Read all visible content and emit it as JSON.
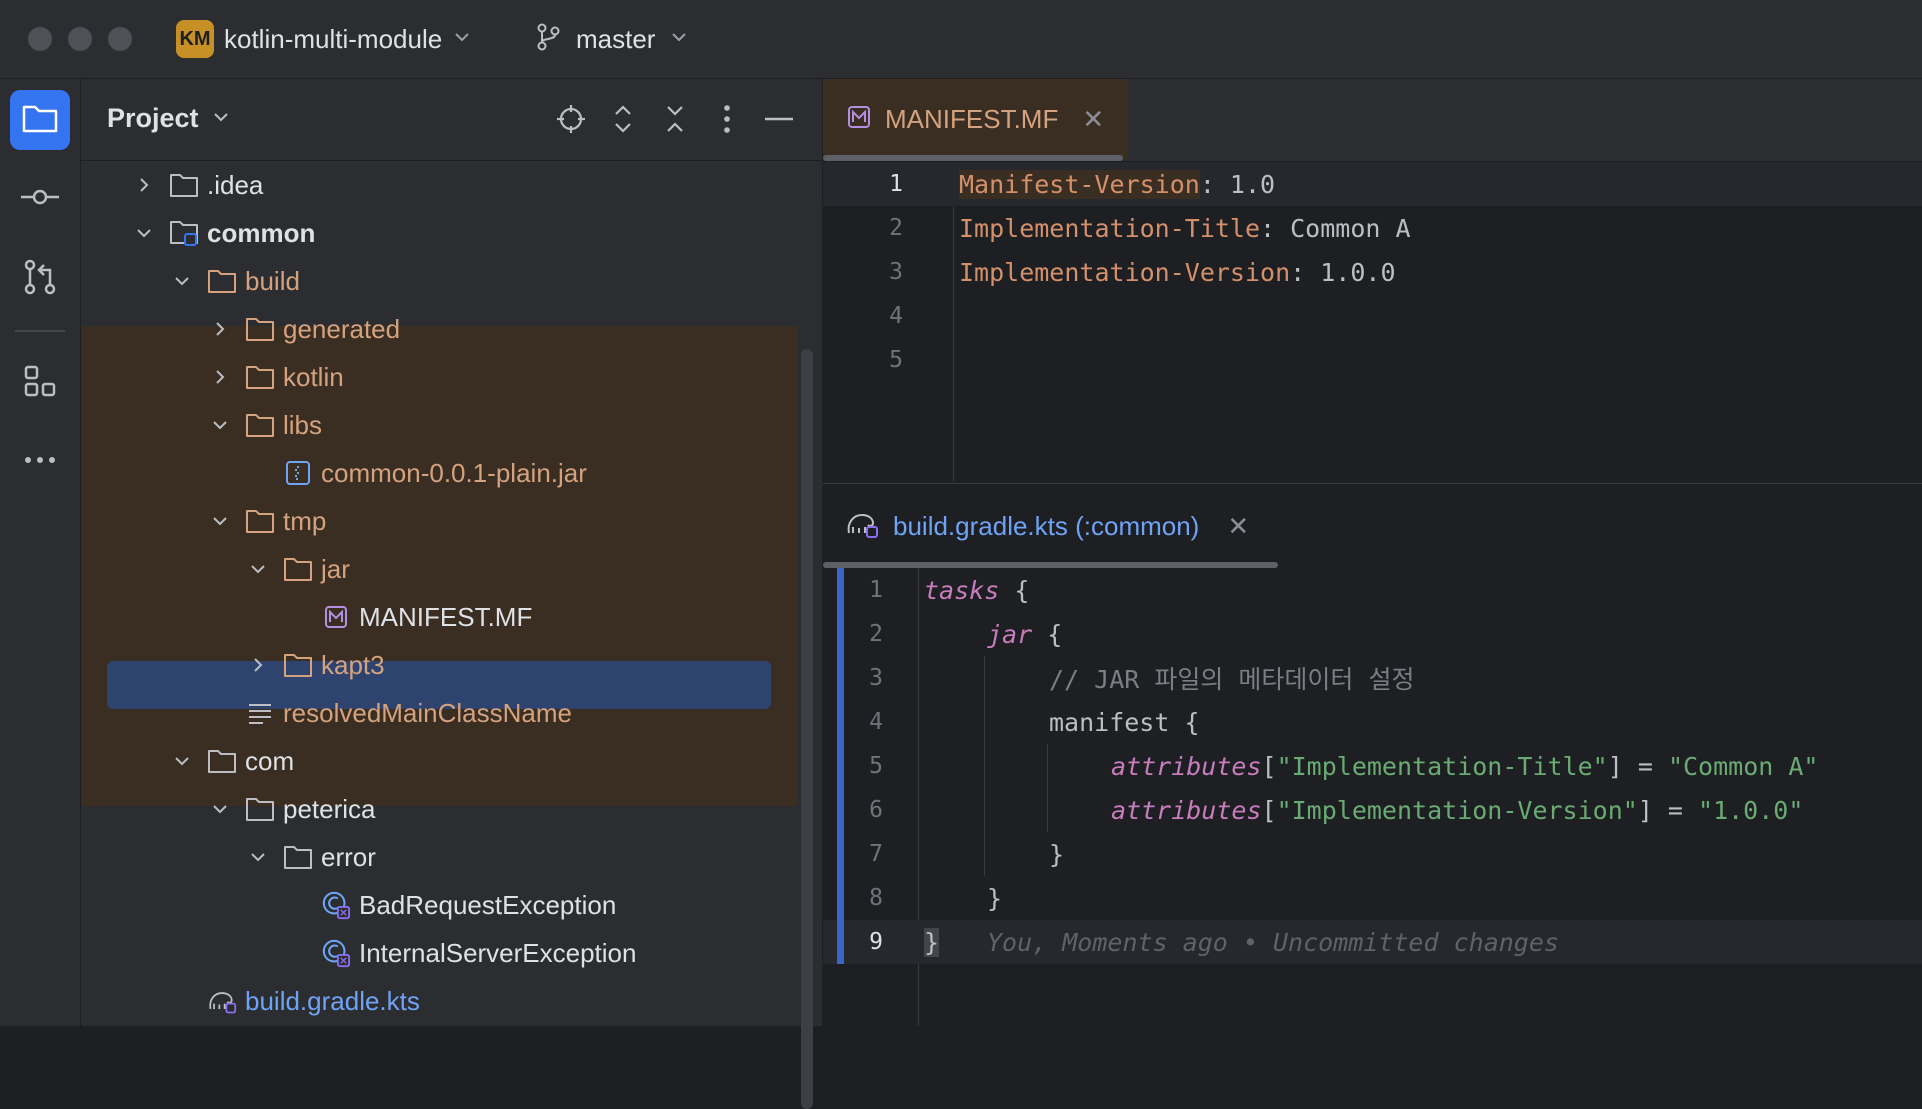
{
  "titlebar": {
    "project_badge": "KM",
    "project_name": "kotlin-multi-module",
    "branch": "master"
  },
  "toolstrip": {
    "items": [
      "project-icon",
      "commit-icon",
      "pull-requests-icon",
      "structure-icon",
      "more-icon"
    ]
  },
  "project_panel": {
    "title": "Project",
    "tree": [
      {
        "label": ".idea",
        "indent": 0,
        "kind": "folder",
        "expanded": false
      },
      {
        "label": "common",
        "indent": 0,
        "kind": "module",
        "expanded": true
      },
      {
        "label": "build",
        "indent": 1,
        "kind": "folder",
        "expanded": true
      },
      {
        "label": "generated",
        "indent": 2,
        "kind": "folder",
        "expanded": false
      },
      {
        "label": "kotlin",
        "indent": 2,
        "kind": "folder",
        "expanded": false
      },
      {
        "label": "libs",
        "indent": 2,
        "kind": "folder",
        "expanded": true
      },
      {
        "label": "common-0.0.1-plain.jar",
        "indent": 3,
        "kind": "jar"
      },
      {
        "label": "tmp",
        "indent": 2,
        "kind": "folder",
        "expanded": true
      },
      {
        "label": "jar",
        "indent": 3,
        "kind": "folder",
        "expanded": true
      },
      {
        "label": "MANIFEST.MF",
        "indent": 4,
        "kind": "manifest",
        "selected": true
      },
      {
        "label": "kapt3",
        "indent": 3,
        "kind": "folder",
        "expanded": false
      },
      {
        "label": "resolvedMainClassName",
        "indent": 2,
        "kind": "text"
      },
      {
        "label": "com",
        "indent": 1,
        "kind": "folder",
        "expanded": true
      },
      {
        "label": "peterica",
        "indent": 2,
        "kind": "folder",
        "expanded": true
      },
      {
        "label": "error",
        "indent": 3,
        "kind": "folder",
        "expanded": true
      },
      {
        "label": "BadRequestException",
        "indent": 4,
        "kind": "kotlin-class"
      },
      {
        "label": "InternalServerException",
        "indent": 4,
        "kind": "kotlin-class"
      },
      {
        "label": "build.gradle.kts",
        "indent": 1,
        "kind": "gradle"
      }
    ]
  },
  "editor_top": {
    "tab_label": "MANIFEST.MF",
    "lines": [
      {
        "n": "1",
        "key": "Manifest-Version",
        "val": ": 1.0"
      },
      {
        "n": "2",
        "key": "Implementation-Title",
        "val": ": Common A"
      },
      {
        "n": "3",
        "key": "Implementation-Version",
        "val": ": 1.0.0"
      },
      {
        "n": "4",
        "key": "",
        "val": ""
      },
      {
        "n": "5",
        "key": "",
        "val": ""
      }
    ]
  },
  "editor_bottom": {
    "tab_label": "build.gradle.kts (:common)",
    "line_numbers": [
      "1",
      "2",
      "3",
      "4",
      "5",
      "6",
      "7",
      "8",
      "9"
    ],
    "code": {
      "l1_kw": "tasks",
      "l1_rest": " {",
      "l2_kw": "jar",
      "l2_rest": " {",
      "l3_comment": "// JAR 파일의 메타데이터 설정",
      "l4_plain": "manifest {",
      "l5_kw": "attributes",
      "l5_a": "[",
      "l5_s1": "\"Implementation-Title\"",
      "l5_b": "] = ",
      "l5_s2": "\"Common A\"",
      "l6_kw": "attributes",
      "l6_a": "[",
      "l6_s1": "\"Implementation-Version\"",
      "l6_b": "] = ",
      "l6_s2": "\"1.0.0\"",
      "l7": "}",
      "l8": "}",
      "l9": "}",
      "l9_blame": "You, Moments ago • Uncommitted changes"
    }
  }
}
